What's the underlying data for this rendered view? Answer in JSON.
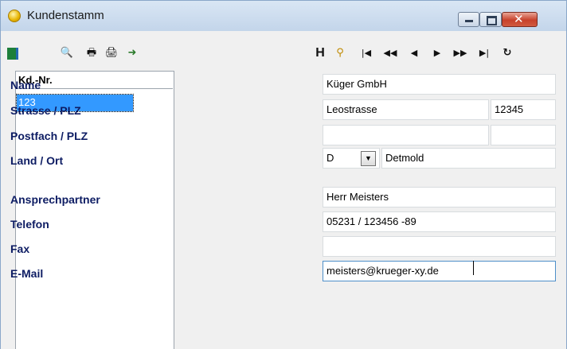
{
  "window": {
    "title": "Kundenstamm"
  },
  "toolbar": {
    "h_label": "H",
    "icons": {
      "exit": "exit-door-icon",
      "preview": "print-preview-icon",
      "print": "printer-icon",
      "print_setup": "print-setup-icon",
      "export": "export-icon",
      "filter": "filter-icon",
      "first": "first-record-icon",
      "prev_page": "prev-page-icon",
      "prev": "prev-record-icon",
      "next": "next-record-icon",
      "next_page": "next-page-icon",
      "last": "last-record-icon",
      "refresh": "refresh-icon"
    }
  },
  "list": {
    "header": "Kd.-Nr.",
    "rows": [
      "123"
    ]
  },
  "form": {
    "labels": {
      "name": "Name",
      "strasse_plz": "Strasse / PLZ",
      "postfach_plz": "Postfach / PLZ",
      "land_ort": "Land / Ort",
      "ansprechpartner": "Ansprechpartner",
      "telefon": "Telefon",
      "fax": "Fax",
      "email": "E-Mail"
    },
    "values": {
      "name": "Küger GmbH",
      "strasse": "Leostrasse",
      "plz": "12345",
      "postfach": "",
      "postfach_plz": "",
      "land": "D",
      "ort": "Detmold",
      "ansprechpartner": "Herr Meisters",
      "telefon": "05231 / 123456 -89",
      "fax": "",
      "email": "meisters@krueger-xy.de"
    }
  },
  "colors": {
    "label_text": "#0d1c63",
    "selection": "#3399ff",
    "titlebar": "#c3d5ea",
    "close_button": "#c7412b"
  }
}
